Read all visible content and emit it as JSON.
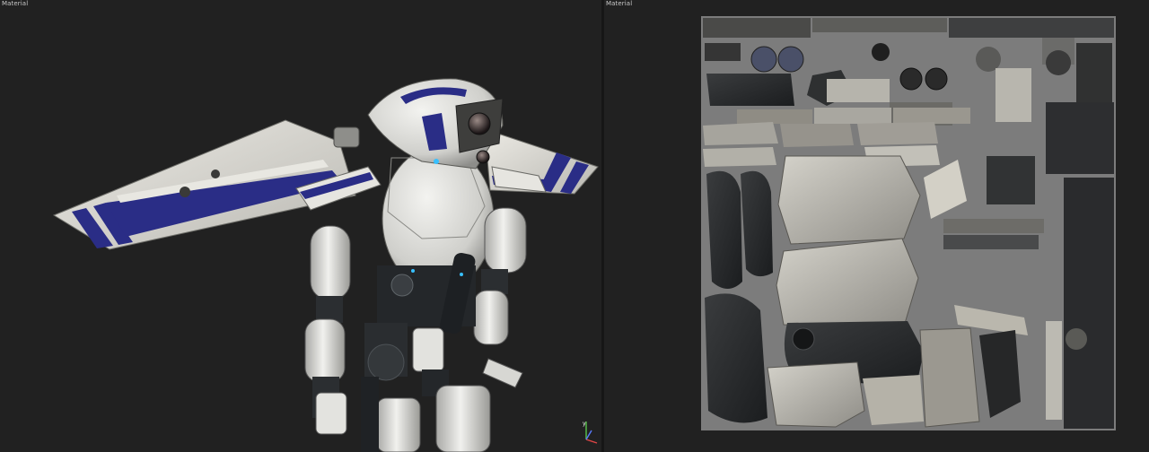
{
  "viewport_3d": {
    "label": "Material",
    "gizmo": "axis-gizmo-icon"
  },
  "viewport_uv": {
    "label": "Material"
  },
  "colors": {
    "background": "#212121",
    "uv_sheet": "#7c7c7c",
    "robot_white": "#e2e2de",
    "robot_stripe": "#2a2d86",
    "metal_dark": "#26292c"
  }
}
